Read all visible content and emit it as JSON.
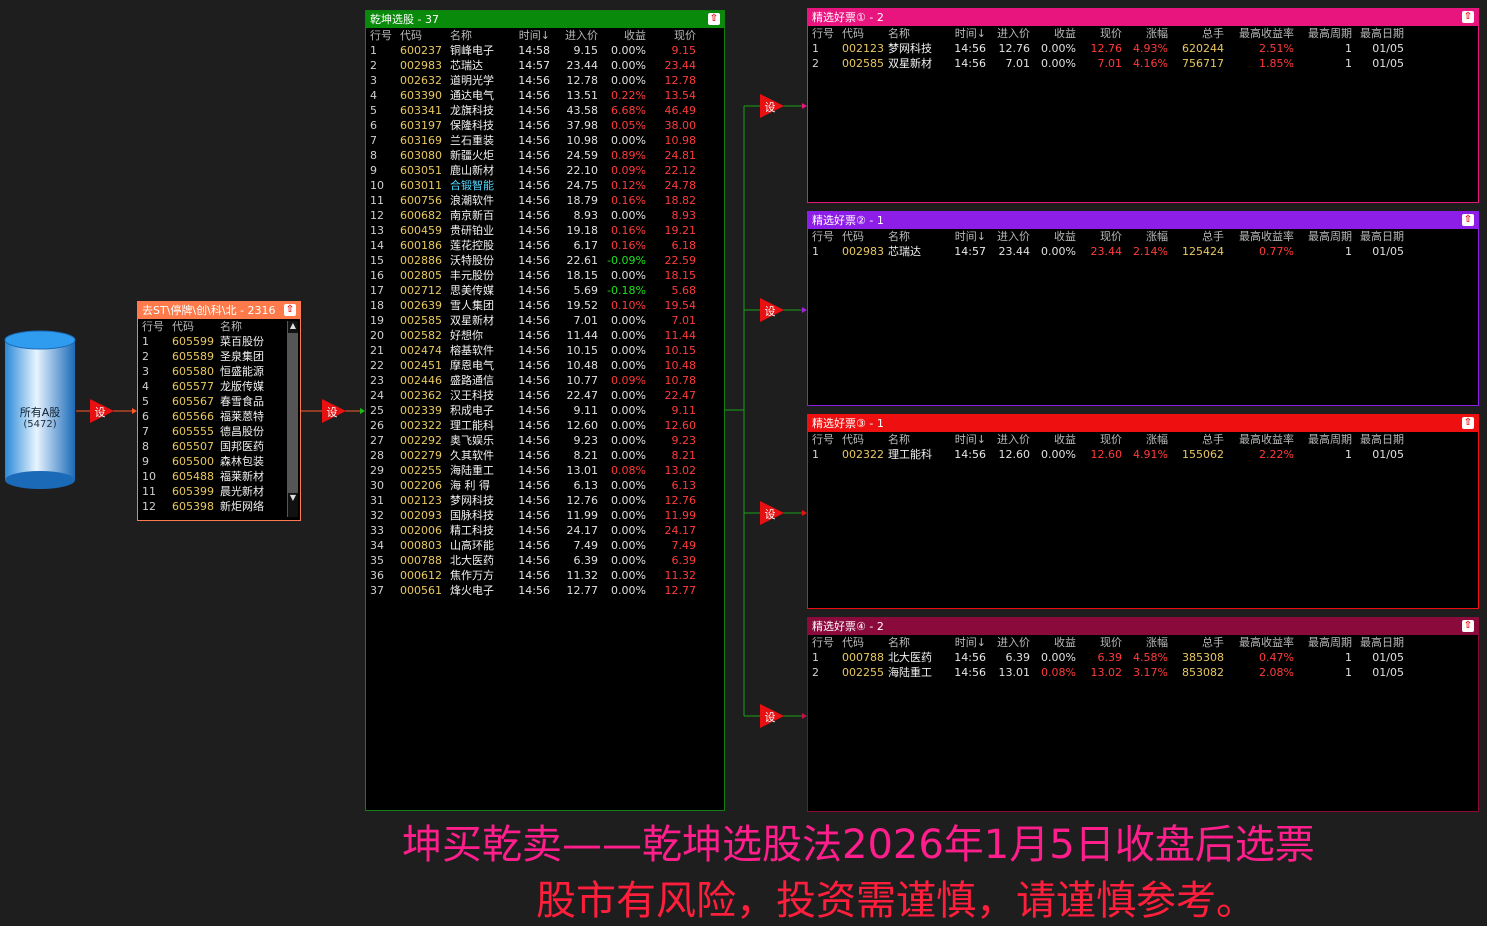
{
  "source": {
    "title": "所有A股",
    "count": "(5472)"
  },
  "set_label": "设",
  "filter": {
    "title": "去ST\\停牌\\创\\科\\北 - 2316",
    "headers": [
      "行号",
      "代码",
      "名称"
    ],
    "rows": [
      [
        "1",
        "605599",
        "菜百股份"
      ],
      [
        "2",
        "605589",
        "圣泉集团"
      ],
      [
        "3",
        "605580",
        "恒盛能源"
      ],
      [
        "4",
        "605577",
        "龙版传媒"
      ],
      [
        "5",
        "605567",
        "春雪食品"
      ],
      [
        "6",
        "605566",
        "福莱蒽特"
      ],
      [
        "7",
        "605555",
        "德昌股份"
      ],
      [
        "8",
        "605507",
        "国邦医药"
      ],
      [
        "9",
        "605500",
        "森林包装"
      ],
      [
        "10",
        "605488",
        "福莱新材"
      ],
      [
        "11",
        "605399",
        "晨光新材"
      ],
      [
        "12",
        "605398",
        "新炬网络"
      ]
    ]
  },
  "main": {
    "title": "乾坤选股 - 37",
    "headers": [
      "行号",
      "代码",
      "名称",
      "时间↓",
      "进入价",
      "收益",
      "现价"
    ],
    "rows": [
      [
        "1",
        "600237",
        "铜峰电子",
        "14:58",
        "9.15",
        "0.00%",
        "9.15",
        "w",
        "r"
      ],
      [
        "2",
        "002983",
        "芯瑞达",
        "14:57",
        "23.44",
        "0.00%",
        "23.44",
        "w",
        "r"
      ],
      [
        "3",
        "002632",
        "道明光学",
        "14:56",
        "12.78",
        "0.00%",
        "12.78",
        "w",
        "r"
      ],
      [
        "4",
        "603390",
        "通达电气",
        "14:56",
        "13.51",
        "0.22%",
        "13.54",
        "r",
        "r"
      ],
      [
        "5",
        "603341",
        "龙旗科技",
        "14:56",
        "43.58",
        "6.68%",
        "46.49",
        "r",
        "r"
      ],
      [
        "6",
        "603197",
        "保隆科技",
        "14:56",
        "37.98",
        "0.05%",
        "38.00",
        "r",
        "r"
      ],
      [
        "7",
        "603169",
        "兰石重装",
        "14:56",
        "10.98",
        "0.00%",
        "10.98",
        "w",
        "r"
      ],
      [
        "8",
        "603080",
        "新疆火炬",
        "14:56",
        "24.59",
        "0.89%",
        "24.81",
        "r",
        "r"
      ],
      [
        "9",
        "603051",
        "鹿山新材",
        "14:56",
        "22.10",
        "0.09%",
        "22.12",
        "r",
        "r"
      ],
      [
        "10",
        "603011",
        "合锻智能",
        "14:56",
        "24.75",
        "0.12%",
        "24.78",
        "r",
        "r",
        "cyan"
      ],
      [
        "11",
        "600756",
        "浪潮软件",
        "14:56",
        "18.79",
        "0.16%",
        "18.82",
        "r",
        "r"
      ],
      [
        "12",
        "600682",
        "南京新百",
        "14:56",
        "8.93",
        "0.00%",
        "8.93",
        "w",
        "r"
      ],
      [
        "13",
        "600459",
        "贵研铂业",
        "14:56",
        "19.18",
        "0.16%",
        "19.21",
        "r",
        "r"
      ],
      [
        "14",
        "600186",
        "莲花控股",
        "14:56",
        "6.17",
        "0.16%",
        "6.18",
        "r",
        "r"
      ],
      [
        "15",
        "002886",
        "沃特股份",
        "14:56",
        "22.61",
        "-0.09%",
        "22.59",
        "g",
        "r"
      ],
      [
        "16",
        "002805",
        "丰元股份",
        "14:56",
        "18.15",
        "0.00%",
        "18.15",
        "w",
        "r"
      ],
      [
        "17",
        "002712",
        "思美传媒",
        "14:56",
        "5.69",
        "-0.18%",
        "5.68",
        "g",
        "r"
      ],
      [
        "18",
        "002639",
        "雪人集团",
        "14:56",
        "19.52",
        "0.10%",
        "19.54",
        "r",
        "r"
      ],
      [
        "19",
        "002585",
        "双星新材",
        "14:56",
        "7.01",
        "0.00%",
        "7.01",
        "w",
        "r"
      ],
      [
        "20",
        "002582",
        "好想你",
        "14:56",
        "11.44",
        "0.00%",
        "11.44",
        "w",
        "r"
      ],
      [
        "21",
        "002474",
        "榕基软件",
        "14:56",
        "10.15",
        "0.00%",
        "10.15",
        "w",
        "r"
      ],
      [
        "22",
        "002451",
        "摩恩电气",
        "14:56",
        "10.48",
        "0.00%",
        "10.48",
        "w",
        "r"
      ],
      [
        "23",
        "002446",
        "盛路通信",
        "14:56",
        "10.77",
        "0.09%",
        "10.78",
        "r",
        "r"
      ],
      [
        "24",
        "002362",
        "汉王科技",
        "14:56",
        "22.47",
        "0.00%",
        "22.47",
        "w",
        "r"
      ],
      [
        "25",
        "002339",
        "积成电子",
        "14:56",
        "9.11",
        "0.00%",
        "9.11",
        "w",
        "r"
      ],
      [
        "26",
        "002322",
        "理工能科",
        "14:56",
        "12.60",
        "0.00%",
        "12.60",
        "w",
        "r"
      ],
      [
        "27",
        "002292",
        "奥飞娱乐",
        "14:56",
        "9.23",
        "0.00%",
        "9.23",
        "w",
        "r"
      ],
      [
        "28",
        "002279",
        "久其软件",
        "14:56",
        "8.21",
        "0.00%",
        "8.21",
        "w",
        "r"
      ],
      [
        "29",
        "002255",
        "海陆重工",
        "14:56",
        "13.01",
        "0.08%",
        "13.02",
        "r",
        "r"
      ],
      [
        "30",
        "002206",
        "海 利 得",
        "14:56",
        "6.13",
        "0.00%",
        "6.13",
        "w",
        "r"
      ],
      [
        "31",
        "002123",
        "梦网科技",
        "14:56",
        "12.76",
        "0.00%",
        "12.76",
        "w",
        "r"
      ],
      [
        "32",
        "002093",
        "国脉科技",
        "14:56",
        "11.99",
        "0.00%",
        "11.99",
        "w",
        "r"
      ],
      [
        "33",
        "002006",
        "精工科技",
        "14:56",
        "24.17",
        "0.00%",
        "24.17",
        "w",
        "r"
      ],
      [
        "34",
        "000803",
        "山高环能",
        "14:56",
        "7.49",
        "0.00%",
        "7.49",
        "w",
        "r"
      ],
      [
        "35",
        "000788",
        "北大医药",
        "14:56",
        "6.39",
        "0.00%",
        "6.39",
        "w",
        "r"
      ],
      [
        "36",
        "000612",
        "焦作万方",
        "14:56",
        "11.32",
        "0.00%",
        "11.32",
        "w",
        "r"
      ],
      [
        "37",
        "000561",
        "烽火电子",
        "14:56",
        "12.77",
        "0.00%",
        "12.77",
        "w",
        "r"
      ]
    ]
  },
  "result_headers": [
    "行号",
    "代码",
    "名称",
    "时间↓",
    "进入价",
    "收益",
    "现价",
    "涨幅",
    "总手",
    "最高收益率",
    "最高周期",
    "最高日期"
  ],
  "results": [
    {
      "title": "精选好票① - 2",
      "color": "#e8157e",
      "rows": [
        [
          "1",
          "002123",
          "梦网科技",
          "14:56",
          "12.76",
          "0.00%",
          "12.76",
          "4.93%",
          "620244",
          "2.51%",
          "1",
          "01/05",
          "w"
        ],
        [
          "2",
          "002585",
          "双星新材",
          "14:56",
          "7.01",
          "0.00%",
          "7.01",
          "4.16%",
          "756717",
          "1.85%",
          "1",
          "01/05",
          "w"
        ]
      ]
    },
    {
      "title": "精选好票② - 1",
      "color": "#8c1ee8",
      "rows": [
        [
          "1",
          "002983",
          "芯瑞达",
          "14:57",
          "23.44",
          "0.00%",
          "23.44",
          "2.14%",
          "125424",
          "0.77%",
          "1",
          "01/05",
          "w"
        ]
      ]
    },
    {
      "title": "精选好票③ - 1",
      "color": "#ee1010",
      "rows": [
        [
          "1",
          "002322",
          "理工能科",
          "14:56",
          "12.60",
          "0.00%",
          "12.60",
          "4.91%",
          "155062",
          "2.22%",
          "1",
          "01/05",
          "w"
        ]
      ]
    },
    {
      "title": "精选好票④ - 2",
      "color": "#8a0a3c",
      "rows": [
        [
          "1",
          "000788",
          "北大医药",
          "14:56",
          "6.39",
          "0.00%",
          "6.39",
          "4.58%",
          "385308",
          "0.47%",
          "1",
          "01/05",
          "w"
        ],
        [
          "2",
          "002255",
          "海陆重工",
          "14:56",
          "13.01",
          "0.08%",
          "13.02",
          "3.17%",
          "853082",
          "2.08%",
          "1",
          "01/05",
          "r"
        ]
      ]
    }
  ],
  "footer": {
    "line1": "坤买乾卖——乾坤选股法2026年1月5日收盘后选票",
    "line2": "股市有风险，投资需谨慎，请谨慎参考。"
  }
}
